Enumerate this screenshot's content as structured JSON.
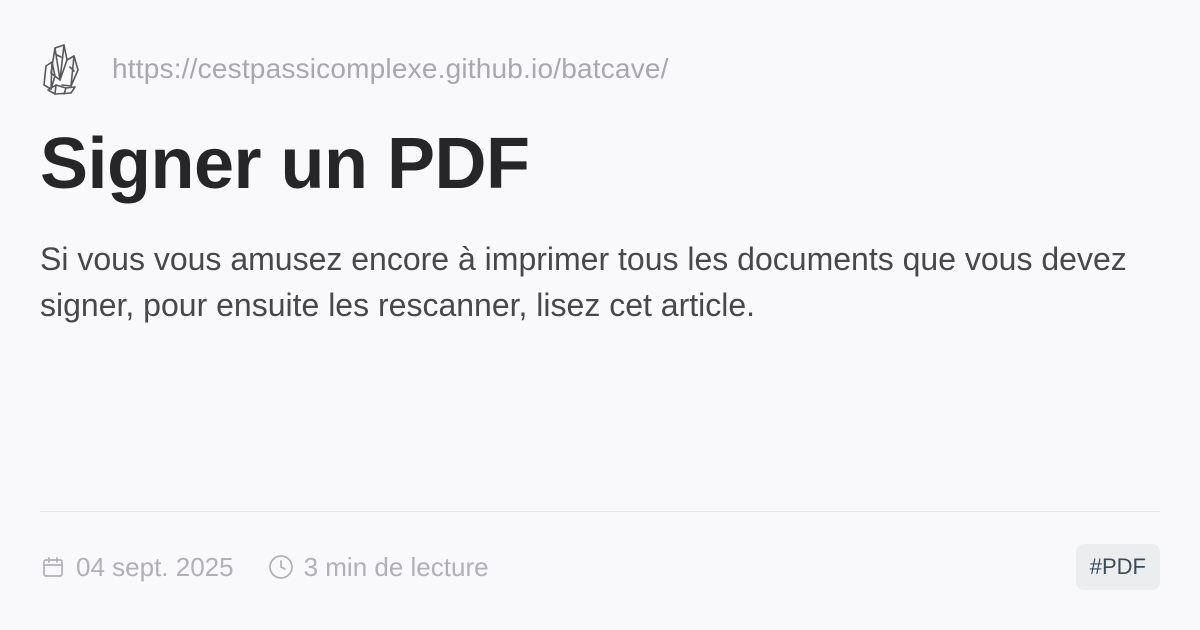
{
  "header": {
    "logo_icon": "crystal-icon",
    "site_url": "https://cestpassicomplexe.github.io/batcave/"
  },
  "article": {
    "title": "Signer un PDF",
    "description": "Si vous vous amusez encore à imprimer tous les documents que vous devez signer, pour ensuite les rescanner, lisez cet article."
  },
  "footer": {
    "date_icon": "calendar-icon",
    "date": "04 sept. 2025",
    "reading_time_icon": "clock-icon",
    "reading_time": "3 min de lecture",
    "tag": "#PDF"
  },
  "colors": {
    "background": "#f9f8fa",
    "title": "#262628",
    "muted": "#a9a9ad",
    "tag_background": "#ecedef",
    "tag_text": "#3b4a57"
  }
}
